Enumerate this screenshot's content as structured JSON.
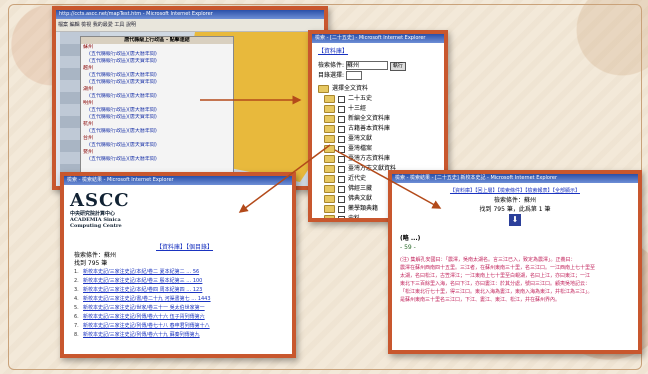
{
  "window_map": {
    "title": "http://ccts.ascc.net/mapTest.htm - Microsoft Internet Explorer",
    "toolbar": "檔案 編輯 檢視 我的最愛 工具 說明",
    "popup_title": "唐代縣級上行政區 - 點擊連結",
    "rows": [
      {
        "kind": "city",
        "text": "蘇州"
      },
      {
        "kind": "link",
        "text": "(五代縣級行政區)(唐大曆年間)"
      },
      {
        "kind": "link",
        "text": "(五代縣級行政區)(唐天寶年間)"
      },
      {
        "kind": "city",
        "text": "越州"
      },
      {
        "kind": "link",
        "text": "(五代縣級行政區)(唐大曆年間)"
      },
      {
        "kind": "link",
        "text": "(五代縣級行政區)(唐天寶年間)"
      },
      {
        "kind": "city",
        "text": "湖州"
      },
      {
        "kind": "link",
        "text": "(五代縣級行政區)(唐大曆年間)"
      },
      {
        "kind": "city",
        "text": "明州"
      },
      {
        "kind": "link",
        "text": "(五代縣級行政區)(唐大曆年間)"
      },
      {
        "kind": "link",
        "text": "(五代縣級行政區)(唐天寶年間)"
      },
      {
        "kind": "city",
        "text": "杭州"
      },
      {
        "kind": "link",
        "text": "(五代縣級行政區)(唐大曆年間)"
      },
      {
        "kind": "city",
        "text": "台州"
      },
      {
        "kind": "link",
        "text": "(五代縣級行政區)(唐天寶年間)"
      },
      {
        "kind": "city",
        "text": "婺州"
      },
      {
        "kind": "link",
        "text": "(五代縣級行政區)(唐大曆年間)"
      }
    ]
  },
  "window_tree": {
    "title": "檢索 - [二十五史] - Microsoft Internet Explorer",
    "top_link": "【資料庫】",
    "search_label": "檢索條件:",
    "search_value": "蘇州",
    "search_button": "執行",
    "scope_label": "目錄選擇:",
    "root_label": "選擇全文資料",
    "items": [
      "二十五史",
      "十三經",
      "新編全文資料庫",
      "古籍善本資料庫",
      "臺灣文獻",
      "臺灣檔案",
      "臺灣方志資料庫",
      "臺灣方志文獻資料",
      "近代史",
      "佛經三藏",
      "佛典文獻",
      "藥學類典籍",
      "史料",
      "近現代文獻"
    ]
  },
  "window_ascc": {
    "title": "檢索 - 檢索結果 - Microsoft Internet Explorer",
    "logo_big": "ASCC",
    "logo_cn": "中央研究院計算中心",
    "logo_en1": "ACADEMIA Sinica",
    "logo_en2": "Computing Centre",
    "nav": "【資料庫】【個目錄】",
    "cond_label": "檢索條件：蘇州",
    "count_label": "找到 795 筆",
    "results": [
      {
        "n": "1.",
        "text": "新校本史記/三家注史記/本紀/卷二 夏本紀第二 … 56"
      },
      {
        "n": "2.",
        "text": "新校本史記/三家注史記/本紀/卷三 殷本紀第三 … 100"
      },
      {
        "n": "3.",
        "text": "新校本史記/三家注史記/本紀/卷四 周本紀第四 … 123"
      },
      {
        "n": "4.",
        "text": "新校本史記/三家注史記/書/卷二十九 河渠書第七 … 1443"
      },
      {
        "n": "5.",
        "text": "新校本史記/三家注史記/世家/卷三十一 吳太伯世家第一"
      },
      {
        "n": "6.",
        "text": "新校本史記/三家注史記/列傳/卷六十六 伍子胥列傳第六"
      },
      {
        "n": "7.",
        "text": "新校本史記/三家注史記/列傳/卷七十八 春申君列傳第十八"
      },
      {
        "n": "8.",
        "text": "新校本史記/三家注史記/列傳/卷六十九 蘇秦列傳第九"
      }
    ]
  },
  "window_text": {
    "title": "檢索 - 檢索結果 - [二十五史] 新校本史記 - Microsoft Internet Explorer",
    "nav": "【資料庫】【回上層】【檢索條件】【檢索報表】【全部顯示】",
    "cond_label": "檢索條件：蘇州",
    "count_label": "找到 795 筆，此爲第 1 筆",
    "heading": "(略 ...)",
    "page": "- 59 -",
    "body_lines": [
      "(注) 集解孔安國曰：「震澤，吳南太湖名。言三江已入，致定為震澤」。正義曰：",
      "震澤在蘇州西南四十五里。三江者，在蘇州東南三十里，名三江口。一江西南上七十里至",
      "太湖，名曰松江，古笠澤江；一江東南上七十里至白蜆湖，名曰上江，亦曰東江；一江",
      "東北下三百餘里入海，名曰下江，亦曰婁江：於其分處，號曰三江口。顧夷吳地記云：",
      "「松江東北行七十里，得三江口。東北入海為婁江，東南入海為東江，并松江為三江」。",
      "是蘇州東南三十里名三江口，下江、婁江、東江、松江，并在蘇州界內。"
    ]
  }
}
